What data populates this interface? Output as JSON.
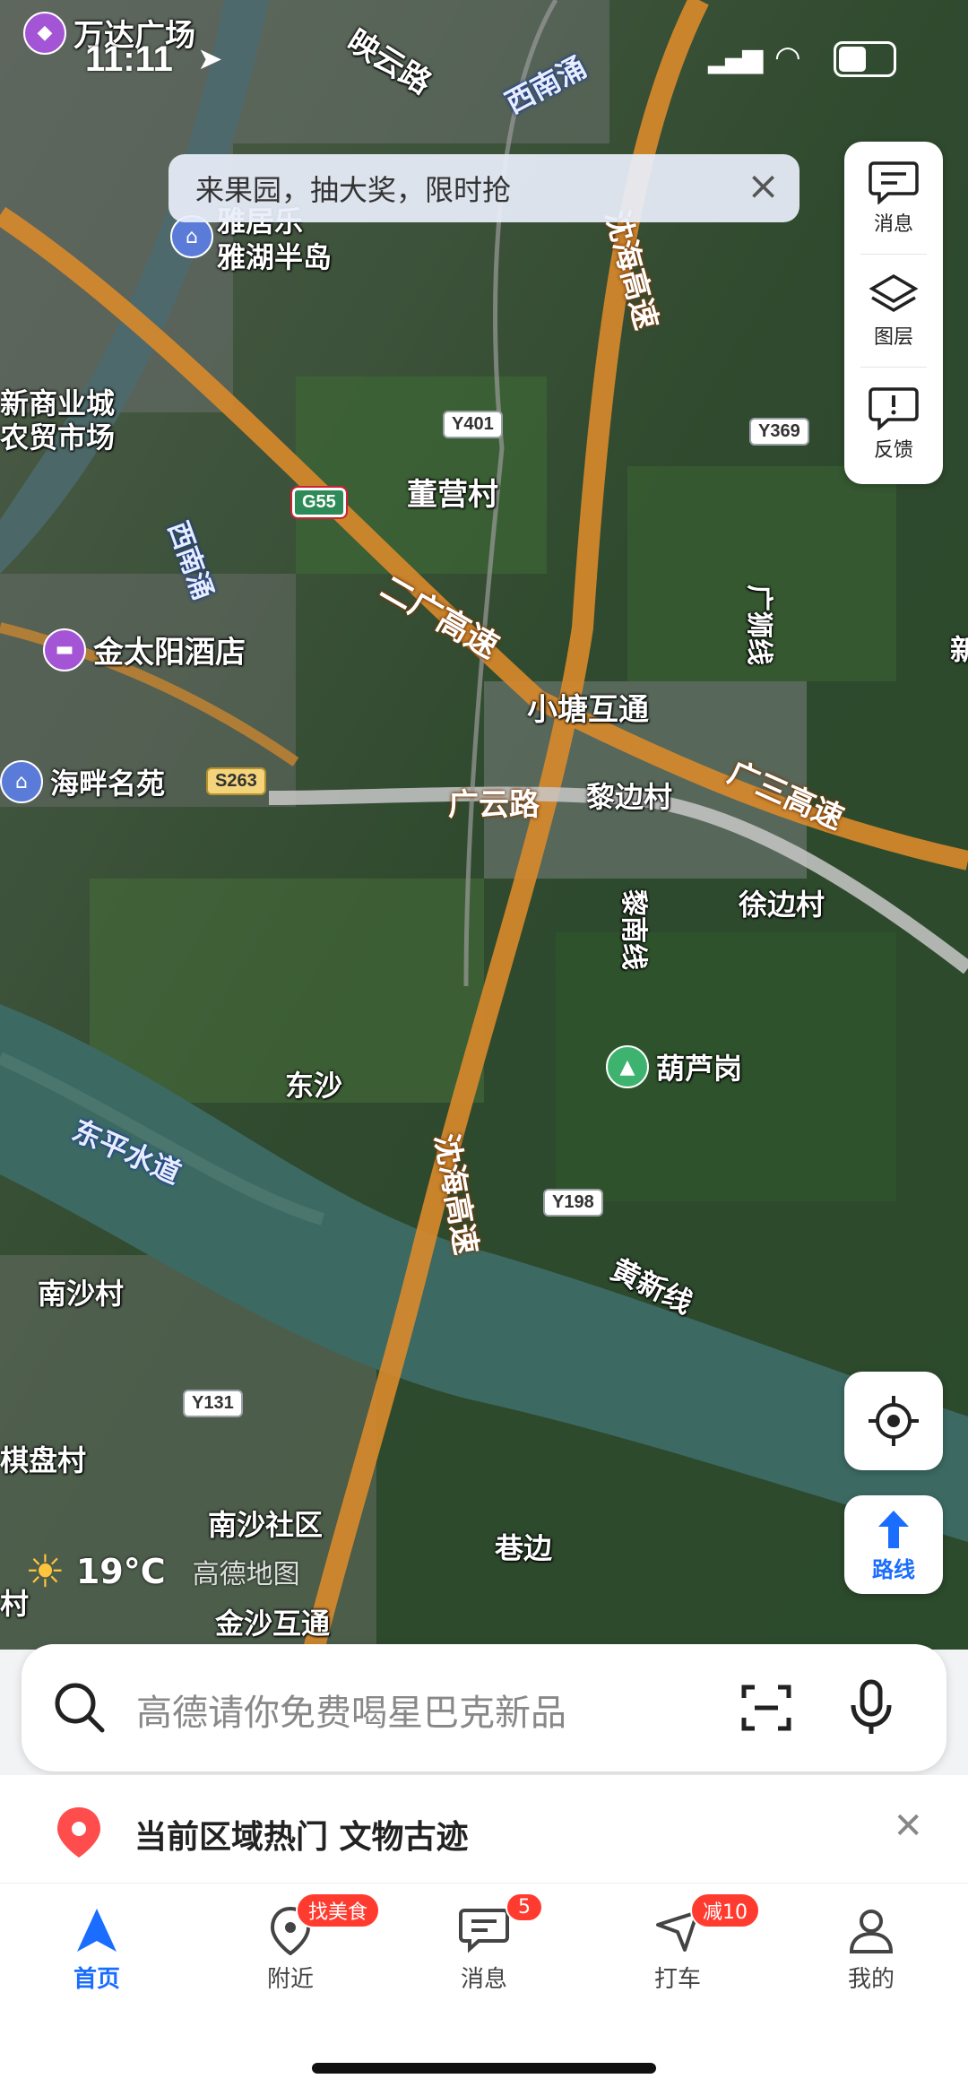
{
  "status": {
    "time": "11:11"
  },
  "banner": {
    "text": "来果园，抽大奖，限时抢"
  },
  "tools": [
    {
      "label": "消息",
      "icon": "message-icon"
    },
    {
      "label": "图层",
      "icon": "layers-icon"
    },
    {
      "label": "反馈",
      "icon": "feedback-icon"
    }
  ],
  "map": {
    "labels": {
      "wanda": "万达广场",
      "yinyun": "映云路",
      "xinanyong_top": "西南涌",
      "shenhai_top": "沈海高速",
      "yahu": "雅湖半岛",
      "yaju": "雅居乐",
      "xinshang": "新商业城",
      "nongmao": "农贸市场",
      "xinan_left": "西南涌",
      "dongying": "董营村",
      "erguang": "二广高速",
      "jintaiyang": "金太阳酒店",
      "xiaotang": "小塘互通",
      "haipan": "海畔名苑",
      "guangyun": "广云路",
      "libian": "黎边村",
      "guangsan": "广三高速",
      "guangshi": "广狮线",
      "xubian": "徐边村",
      "linan": "黎南线",
      "hulugang": "葫芦岗",
      "dongsha": "东沙",
      "dongping": "东平水道",
      "shenhai_bottom": "沈海高速",
      "huangxin": "黄新线",
      "nansha": "南沙村",
      "qipan": "棋盘村",
      "nanshashequ": "南沙社区",
      "xiangbian": "巷边",
      "jinsha": "金沙互通",
      "xin": "新",
      "cun": "村"
    },
    "shields": {
      "y401": "Y401",
      "y369": "Y369",
      "g55": "G55",
      "s263": "S263",
      "y198": "Y198",
      "y131": "Y131"
    }
  },
  "weather": {
    "temp": "19°C",
    "brand": "高德地图"
  },
  "buttons": {
    "route": "路线"
  },
  "search": {
    "placeholder": "高德请你免费喝星巴克新品"
  },
  "hot": {
    "text": "当前区域热门 文物古迹"
  },
  "tabs": [
    {
      "label": "首页",
      "badge": ""
    },
    {
      "label": "附近",
      "badge": "找美食"
    },
    {
      "label": "消息",
      "badge": "5"
    },
    {
      "label": "打车",
      "badge": "减10"
    },
    {
      "label": "我的",
      "badge": ""
    }
  ],
  "colors": {
    "accent": "#1a6dff",
    "badge": "#ff3b30",
    "highway": "#d98a2b",
    "water": "#3c6a63"
  }
}
